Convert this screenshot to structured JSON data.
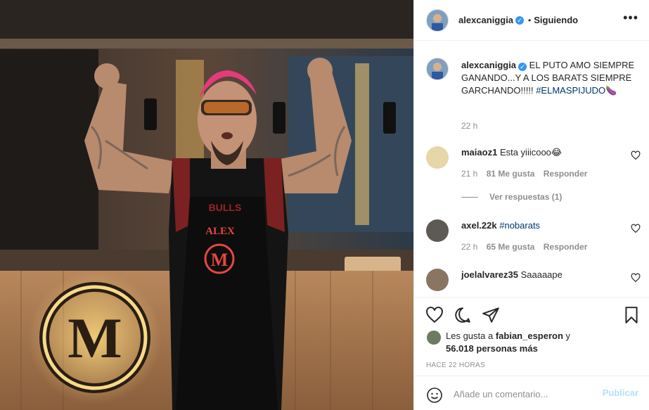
{
  "post_image": {
    "apron_text": "ALEX",
    "jersey_text": "BULLS",
    "logo_letter": "M"
  },
  "header": {
    "username": "alexcaniggia",
    "separator": "•",
    "follow_status": "Siguiendo",
    "more": "•••"
  },
  "caption": {
    "username": "alexcaniggia",
    "text": "EL PUTO AMO SIEMPRE GANANDO...Y A LOS BARATS SIEMPRE GARCHANDO!!!!! ",
    "hashtag": "#ELMASPIJUDO",
    "emoji": "🍆",
    "time": "22 h"
  },
  "comments": [
    {
      "username": "maiaoz1",
      "text": "Esta yiiicooo😂",
      "time": "21 h",
      "likes": "81 Me gusta",
      "reply": "Responder",
      "view_replies": "Ver respuestas (1)"
    },
    {
      "username": "axel.22k",
      "text": "#nobarats",
      "time": "22 h",
      "likes": "65 Me gusta",
      "reply": "Responder"
    },
    {
      "username": "joelalvarez35",
      "text": "Saaaaape"
    }
  ],
  "likes": {
    "prefix": "Les gusta a ",
    "user": "fabian_esperon",
    "conj": " y",
    "count": "56.018 personas más"
  },
  "posted": "HACE 22 HORAS",
  "add_comment": {
    "placeholder": "Añade un comentario...",
    "publish": "Publicar"
  },
  "colors": {
    "link": "#00376b",
    "verified": "#3897f0",
    "publish_disabled": "#b2dffc",
    "muted": "#8e8e8e"
  }
}
